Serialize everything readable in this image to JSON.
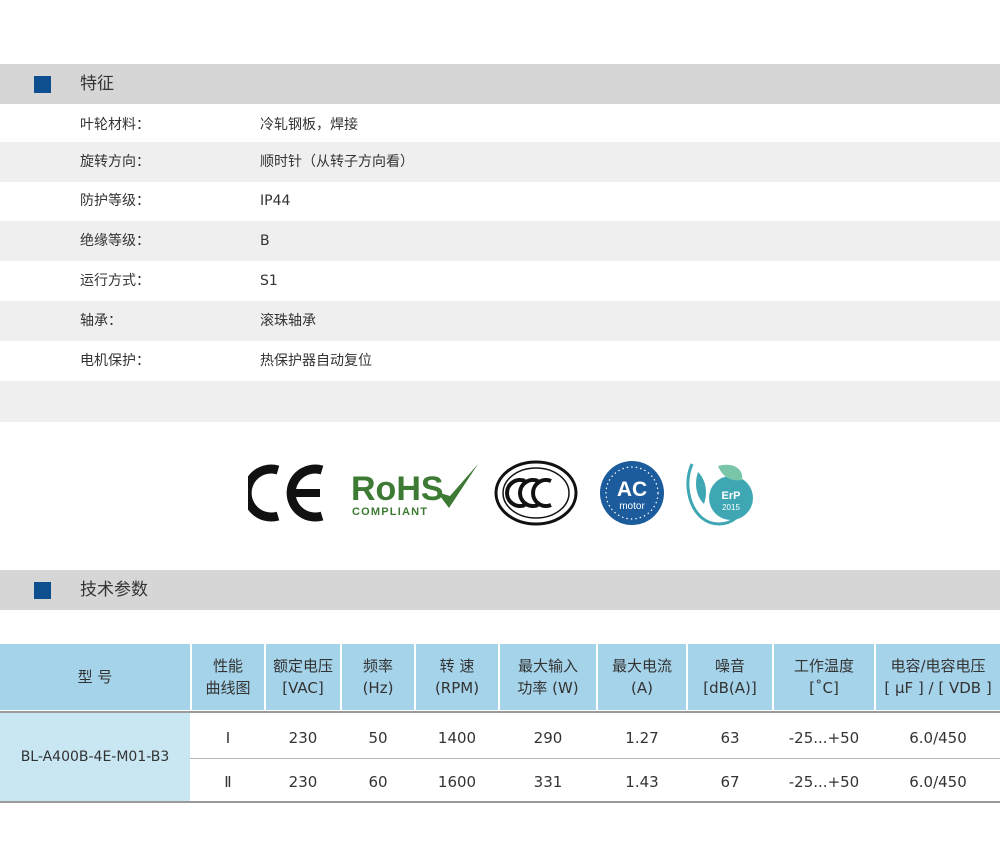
{
  "features": {
    "section_title": "特征",
    "rows": [
      {
        "label": "叶轮材料：",
        "value": "冷轧钢板，焊接"
      },
      {
        "label": "旋转方向：",
        "value": "顺时针（从转子方向看）"
      },
      {
        "label": "防护等级：",
        "value": "IP44"
      },
      {
        "label": "绝缘等级：",
        "value": "B"
      },
      {
        "label": "运行方式：",
        "value": "S1"
      },
      {
        "label": "轴承：",
        "value": "滚珠轴承"
      },
      {
        "label": "电机保护：",
        "value": "热保护器自动复位"
      }
    ]
  },
  "certifications": {
    "ce": "CE",
    "rohs": {
      "title": "RoHS",
      "sub": "COMPLIANT"
    },
    "ccc": "CCC",
    "ac_motor": {
      "title": "AC",
      "sub": "motor"
    },
    "erp": {
      "title": "ErP",
      "year": "2015"
    }
  },
  "specs": {
    "section_title": "技术参数",
    "headers": [
      "型 号",
      "性能\n曲线图",
      "额定电压\n[VAC]",
      "频率\n(Hz)",
      "转 速\n(RPM)",
      "最大输入\n功率 (W)",
      "最大电流\n(A)",
      "噪音\n[dB(A)]",
      "工作温度\n[˚C]",
      "电容/电容电压\n[ μF ] / [ VDB ]"
    ],
    "model": "BL-A400B-4E-M01-B3",
    "rows": [
      {
        "curve": "Ⅰ",
        "voltage": "230",
        "freq": "50",
        "speed": "1400",
        "power": "290",
        "current": "1.27",
        "noise": "63",
        "temp": "-25...+50",
        "capacitor": "6.0/450"
      },
      {
        "curve": "Ⅱ",
        "voltage": "230",
        "freq": "60",
        "speed": "1600",
        "power": "331",
        "current": "1.43",
        "noise": "67",
        "temp": "-25...+50",
        "capacitor": "6.0/450"
      }
    ]
  },
  "colors": {
    "accent_marker": "#0d4f8f",
    "section_bar": "#d6d6d6",
    "table_header": "#a5d3ea",
    "model_cell": "#c9e6f3",
    "rohs_green": "#3d7a33",
    "ac_blue": "#1c5b9c",
    "erp_teal": "#3fa7b3"
  }
}
